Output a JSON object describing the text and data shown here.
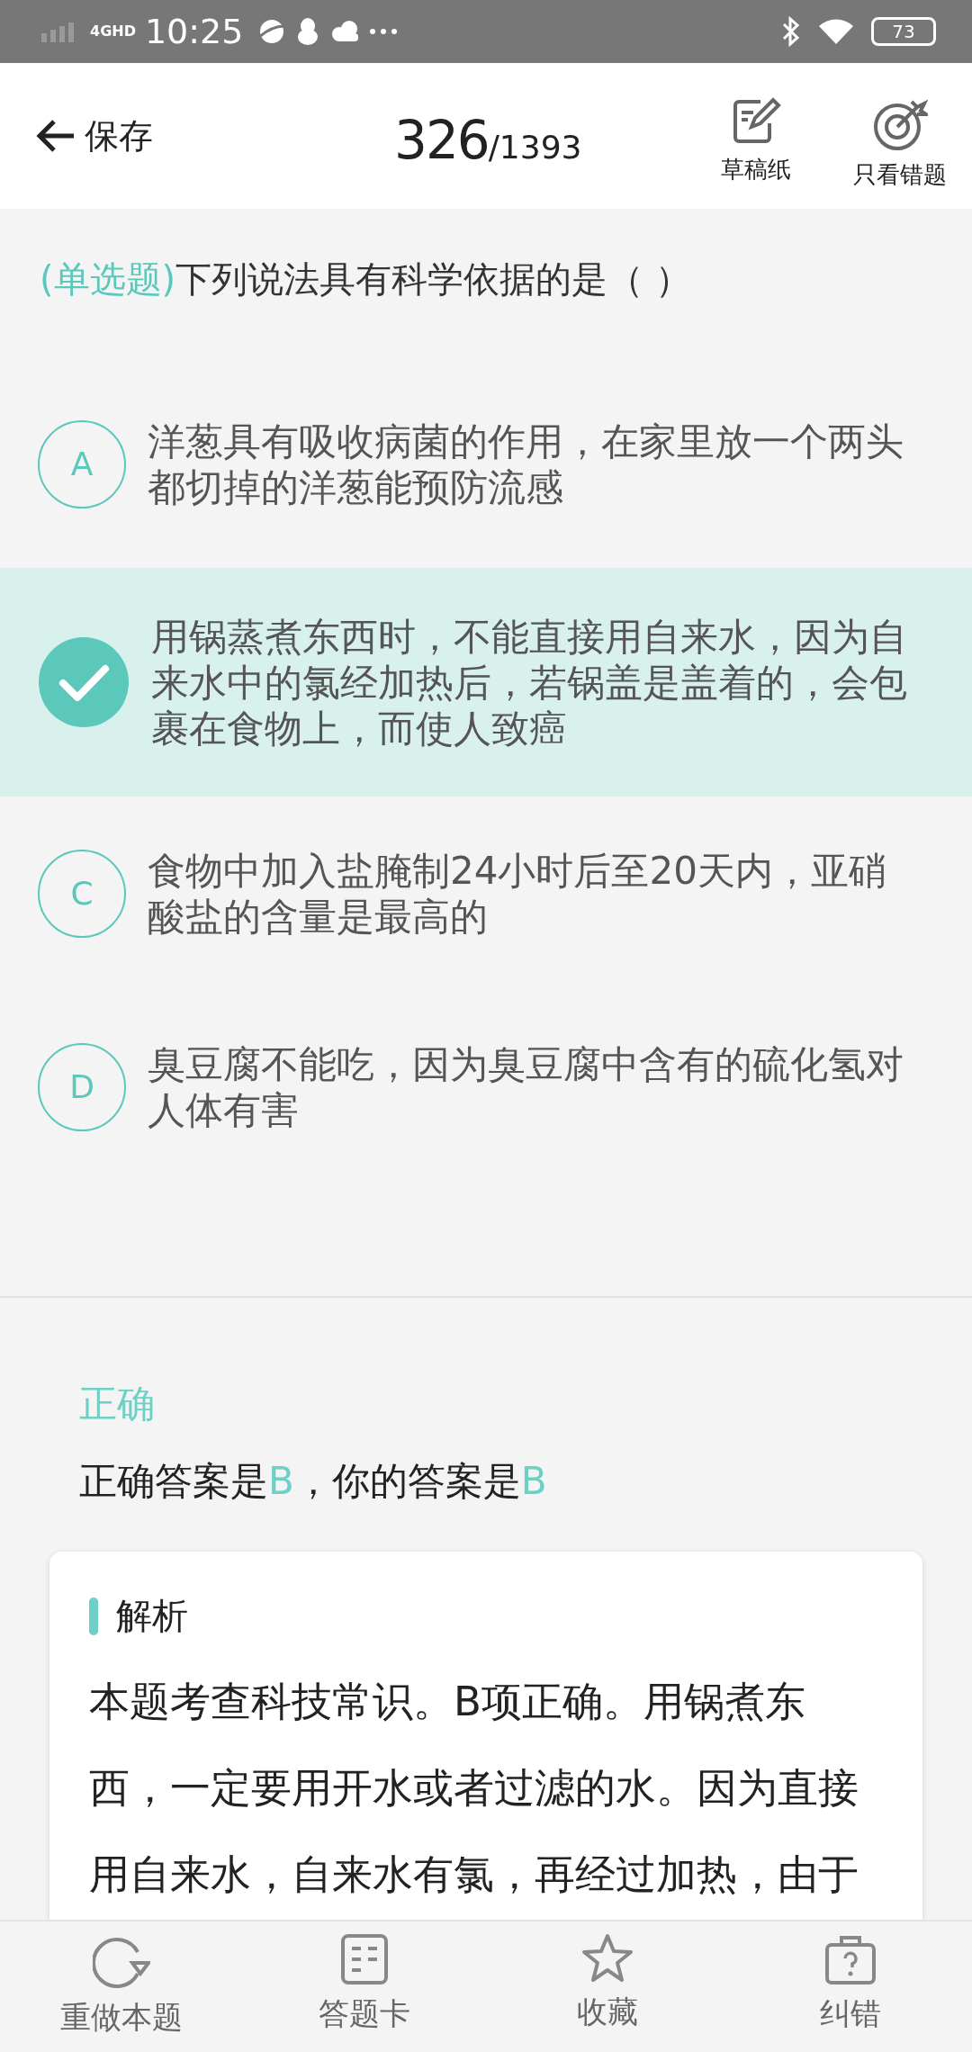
{
  "status_bar": {
    "network": "4GHD",
    "time": "10:25",
    "battery": "73"
  },
  "header": {
    "back_label": "保存",
    "current": "326",
    "total": "/1393",
    "actions": [
      {
        "label": "草稿纸"
      },
      {
        "label": "只看错题"
      }
    ]
  },
  "question": {
    "type_label": "(单选题)",
    "text": "下列说法具有科学依据的是（ ）"
  },
  "options": [
    {
      "letter": "A",
      "text": "洋葱具有吸收病菌的作用，在家里放一个两头都切掉的洋葱能预防流感",
      "selected": false
    },
    {
      "text": "用锅蒸煮东西时，不能直接用自来水，因为自来水中的氯经加热后，若锅盖是盖着的，会包裹在食物上，而使人致癌",
      "selected": true
    },
    {
      "letter": "C",
      "text": "食物中加入盐腌制24小时后至20天内，亚硝酸盐的含量是最高的",
      "selected": false
    },
    {
      "letter": "D",
      "text": "臭豆腐不能吃，因为臭豆腐中含有的硫化氢对人体有害",
      "selected": false
    }
  ],
  "result": {
    "verdict": "正确",
    "answer_prefix": "正确答案是",
    "correct_answer": "B",
    "your_prefix": "，你的答案是",
    "your_answer": "B"
  },
  "analysis": {
    "title": "解析",
    "text": "本题考查科技常识。B项正确。用锅煮东西，一定要用开水或者过滤的水。因为直接用自来水，自来水有氯，再经过加热，由于"
  },
  "bottom_nav": [
    {
      "label": "重做本题"
    },
    {
      "label": "答题卡"
    },
    {
      "label": "收藏"
    },
    {
      "label": "纠错"
    }
  ]
}
